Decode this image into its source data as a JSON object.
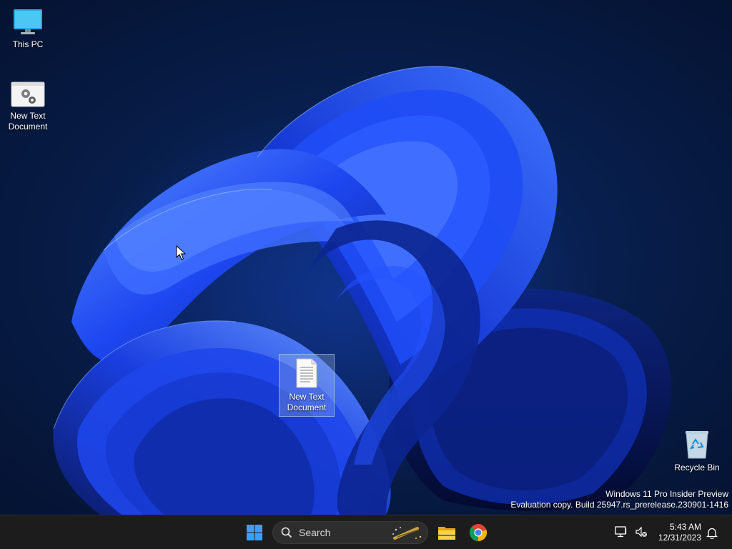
{
  "desktop": {
    "icons": {
      "this_pc": {
        "label": "This PC"
      },
      "new_text_doc_top": {
        "label_line1": "New Text",
        "label_line2": "Document"
      },
      "new_text_doc_center": {
        "label_line1": "New Text",
        "label_line2": "Document"
      },
      "recycle_bin": {
        "label": "Recycle Bin"
      }
    },
    "watermark": {
      "line1": "Windows 11 Pro Insider Preview",
      "line2": "Evaluation copy. Build 25947.rs_prerelease.230901-1416"
    }
  },
  "taskbar": {
    "start": {
      "icon": "windows-start-icon"
    },
    "search": {
      "placeholder": "Search",
      "icon": "search-icon"
    },
    "pinned": [
      {
        "name": "File Explorer",
        "icon": "folder-icon"
      },
      {
        "name": "Google Chrome",
        "icon": "chrome-icon"
      }
    ],
    "tray": {
      "network_icon": "network-icon",
      "volume_icon": "volume-muted-icon",
      "notification_icon": "bell-icon"
    },
    "clock": {
      "time": "5:43 AM",
      "date": "12/31/2023"
    }
  },
  "colors": {
    "taskbar_bg": "#1c1c1c",
    "wallpaper_dark": "#06173a",
    "bloom_blue": "#1f4fff",
    "start_blue": "#3aa0ff"
  }
}
